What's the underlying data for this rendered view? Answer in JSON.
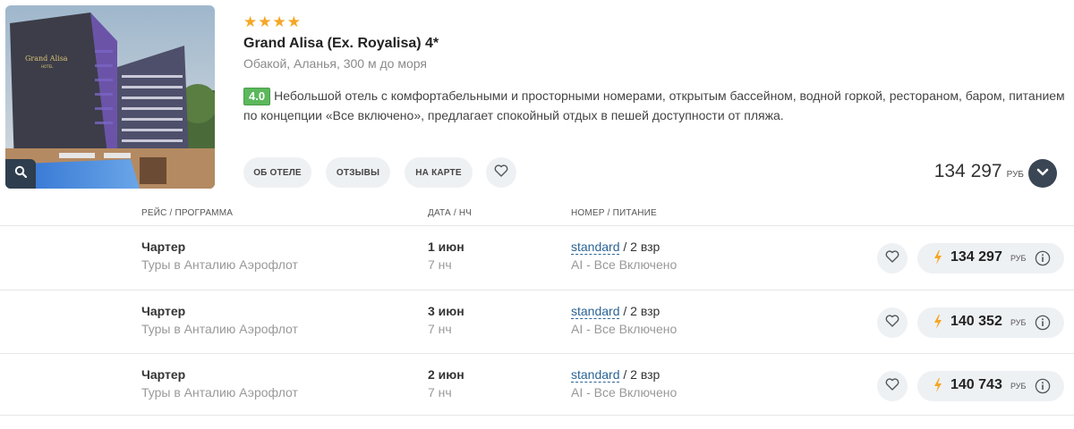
{
  "hotel": {
    "stars": 4,
    "name": "Grand Alisa (Ex. Royalisa) 4*",
    "location": "Обакой, Аланья, 300 м до моря",
    "rating": "4.0",
    "description": "Небольшой отель с комфортабельными и просторными номерами, открытым бассейном, водной горкой, рестораном, баром, питанием по концепции «Все включено», предлагает спокойный отдых в пешей доступности от пляжа.",
    "photo_sign": "Grand Alisa",
    "photo_sign_sub": "HOTEL"
  },
  "buttons": {
    "about": "ОБ ОТЕЛЕ",
    "reviews": "ОТЗЫВЫ",
    "map": "НА КАРТЕ"
  },
  "main_price": {
    "value": "134 297",
    "currency": "РУБ"
  },
  "columns": {
    "flight": "РЕЙС / ПРОГРАММА",
    "date": "ДАТА / НЧ",
    "room": "НОМЕР / ПИТАНИЕ"
  },
  "offers": [
    {
      "flight": "Чартер",
      "program": "Туры в Анталию Аэрофлот",
      "date": "1 июн",
      "nights": "7 нч",
      "room": "standard",
      "guests": " / 2 взр",
      "meal": "AI - Все Включено",
      "price": "134 297",
      "currency": "РУБ"
    },
    {
      "flight": "Чартер",
      "program": "Туры в Анталию Аэрофлот",
      "date": "3 июн",
      "nights": "7 нч",
      "room": "standard",
      "guests": " / 2 взр",
      "meal": "AI - Все Включено",
      "price": "140 352",
      "currency": "РУБ"
    },
    {
      "flight": "Чартер",
      "program": "Туры в Анталию Аэрофлот",
      "date": "2 июн",
      "nights": "7 нч",
      "room": "standard",
      "guests": " / 2 взр",
      "meal": "AI - Все Включено",
      "price": "140 743",
      "currency": "РУБ"
    }
  ],
  "icons": {
    "zoom": "search-icon",
    "favorite": "heart-icon",
    "expand": "chevron-down-icon",
    "bolt": "lightning-icon",
    "info": "info-icon"
  },
  "colors": {
    "star": "#f5a623",
    "rating_bg": "#5cb85c",
    "link": "#2a6496",
    "dark_button": "#3a4654",
    "bolt": "#f5a623"
  }
}
